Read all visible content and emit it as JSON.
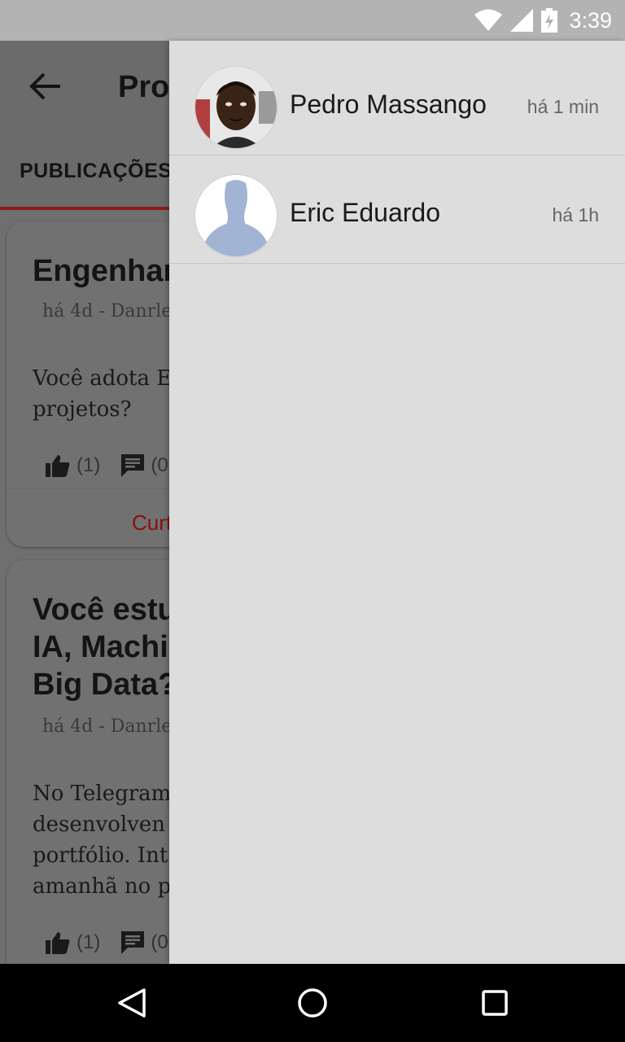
{
  "status_bar": {
    "time": "3:39",
    "icons": [
      "wifi-icon",
      "signal-icon",
      "battery-charging-icon"
    ]
  },
  "app": {
    "title": "Pro",
    "tab_active": "PUBLICAÇÕES",
    "cards": [
      {
        "title": "Engenhar",
        "meta": "há 4d - Danrle",
        "body": [
          "Você adota E",
          "projetos?"
        ],
        "likes": "(1)",
        "comments": "(0",
        "action": "Curt"
      },
      {
        "title": [
          "Você estu",
          "IA, Machi",
          "Big Data?"
        ],
        "meta": "há 4d - Danrle",
        "body": [
          "No Telegram",
          "desenvolven",
          "portfólio. Int",
          "amanhã no p"
        ],
        "likes": "(1)",
        "comments": "(0"
      }
    ]
  },
  "drawer": {
    "conversations": [
      {
        "name": "Pedro Massango",
        "time": "há 1  min",
        "avatar": "photo"
      },
      {
        "name": "Eric Eduardo",
        "time": "há 1h",
        "avatar": "default-silhouette"
      }
    ]
  },
  "colors": {
    "accent": "#b71c1c",
    "drawer_bg": "#dddddd",
    "status_bar": "#b3b3b3"
  }
}
